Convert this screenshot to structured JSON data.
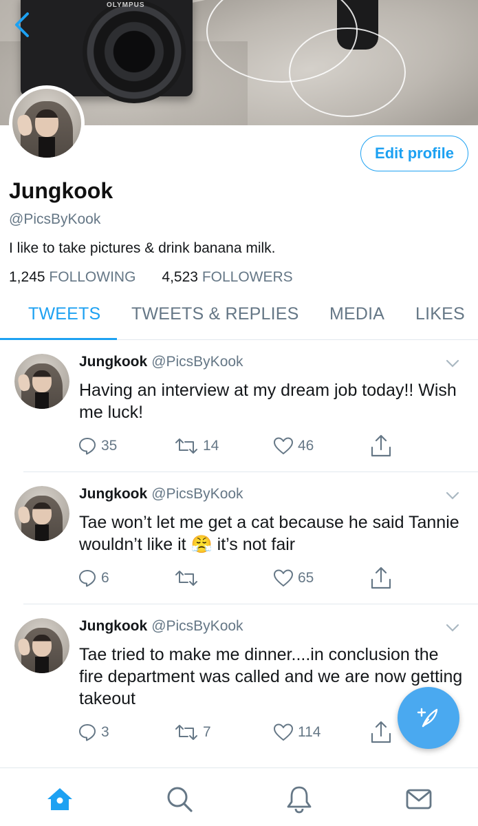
{
  "profile": {
    "name": "Jungkook",
    "handle": "@PicsByKook",
    "bio": "I like to take pictures & drink banana milk.",
    "following_count": "1,245",
    "following_label": "FOLLOWING",
    "followers_count": "4,523",
    "followers_label": "FOLLOWERS",
    "edit_label": "Edit profile"
  },
  "banner": {
    "camera_brand": "OLYMPUS"
  },
  "tabs": [
    {
      "label": "TWEETS",
      "active": true
    },
    {
      "label": "TWEETS & REPLIES",
      "active": false
    },
    {
      "label": "MEDIA",
      "active": false
    },
    {
      "label": "LIKES",
      "active": false
    }
  ],
  "tweets": [
    {
      "name": "Jungkook",
      "handle": "@PicsByKook",
      "text": "Having an interview at my dream job today!! Wish me luck!",
      "replies": "35",
      "retweets": "14",
      "likes": "46"
    },
    {
      "name": "Jungkook",
      "handle": "@PicsByKook",
      "text": "Tae won’t let me get a cat because he said Tannie wouldn’t like it 😤 it’s not fair",
      "replies": "6",
      "retweets": "",
      "likes": "65"
    },
    {
      "name": "Jungkook",
      "handle": "@PicsByKook",
      "text": "Tae tried to make me dinner....in conclusion the fire department was called and we are now getting takeout",
      "replies": "3",
      "retweets": "7",
      "likes": "114"
    }
  ],
  "colors": {
    "accent": "#1da1f2",
    "secondary_text": "#657786",
    "primary_text": "#14171a",
    "fab": "#4aa9f0"
  },
  "icons": {
    "back": "chevron-left-icon",
    "reply": "reply-bubble-icon",
    "retweet": "retweet-icon",
    "like": "heart-icon",
    "share": "share-icon",
    "more": "chevron-down-icon",
    "compose": "compose-feather-icon",
    "home": "home-icon",
    "search": "search-icon",
    "notifications": "bell-icon",
    "messages": "mail-icon"
  }
}
